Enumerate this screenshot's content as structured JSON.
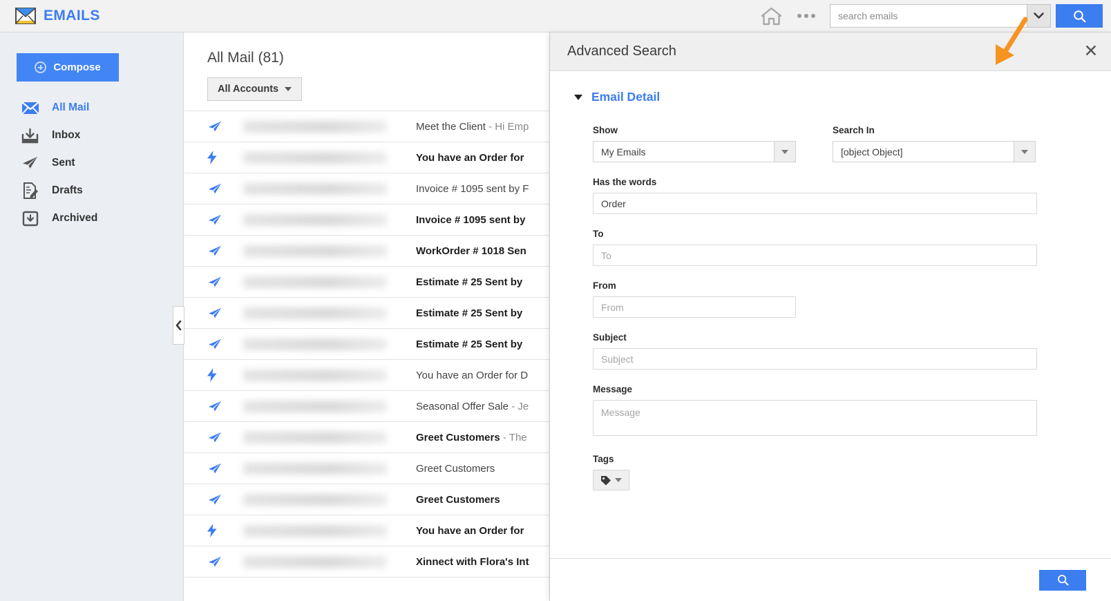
{
  "app": {
    "brand": "EMAILS",
    "brand_icon": "envelope-icon",
    "accent_blue": "#3c7df0",
    "annotation_color": "#f79421"
  },
  "topbar": {
    "home_icon": "home-icon",
    "more_icon": "more-options-icon",
    "search_placeholder": "search emails",
    "search_value": "",
    "dropdown_icon": "chevron-down-icon",
    "search_button_icon": "search-icon"
  },
  "sidebar": {
    "compose_label": "Compose",
    "compose_icon": "plus-circle-icon",
    "items": [
      {
        "label": "All Mail",
        "icon": "envelope-icon",
        "active": true
      },
      {
        "label": "Inbox",
        "icon": "inbox-tray-icon",
        "active": false
      },
      {
        "label": "Sent",
        "icon": "paper-plane-icon",
        "active": false
      },
      {
        "label": "Drafts",
        "icon": "draft-pencil-icon",
        "active": false
      },
      {
        "label": "Archived",
        "icon": "archive-box-icon",
        "active": false
      }
    ],
    "collapse_icon": "chevron-left-icon"
  },
  "list": {
    "title": "All Mail (81)",
    "accounts_filter": "All Accounts",
    "accounts_caret_icon": "caret-down-icon",
    "rows": [
      {
        "icon": "paper-plane-icon",
        "subject": "Meet the Client",
        "preview": " - Hi Emp",
        "unread": false
      },
      {
        "icon": "lightning-bolt-icon",
        "subject": "You have an Order for",
        "preview": "",
        "unread": true
      },
      {
        "icon": "paper-plane-icon",
        "subject": "Invoice # 1095 sent by F",
        "preview": "",
        "unread": false
      },
      {
        "icon": "paper-plane-icon",
        "subject": "Invoice # 1095 sent by",
        "preview": "",
        "unread": true
      },
      {
        "icon": "paper-plane-icon",
        "subject": "WorkOrder # 1018 Sen",
        "preview": "",
        "unread": true
      },
      {
        "icon": "paper-plane-icon",
        "subject": "Estimate # 25 Sent by",
        "preview": "",
        "unread": true
      },
      {
        "icon": "paper-plane-icon",
        "subject": "Estimate # 25 Sent by",
        "preview": "",
        "unread": true
      },
      {
        "icon": "paper-plane-icon",
        "subject": "Estimate # 25 Sent by",
        "preview": "",
        "unread": true
      },
      {
        "icon": "lightning-bolt-icon",
        "subject": "You have an Order for D",
        "preview": "",
        "unread": false
      },
      {
        "icon": "paper-plane-icon",
        "subject": "Seasonal Offer Sale",
        "preview": " - Je",
        "unread": false
      },
      {
        "icon": "paper-plane-icon",
        "subject": "Greet Customers",
        "preview": " - The",
        "unread": true
      },
      {
        "icon": "paper-plane-icon",
        "subject": "Greet Customers",
        "preview": "",
        "unread": false
      },
      {
        "icon": "paper-plane-icon",
        "subject": "Greet Customers",
        "preview": "",
        "unread": true
      },
      {
        "icon": "lightning-bolt-icon",
        "subject": "You have an Order for",
        "preview": "",
        "unread": true
      },
      {
        "icon": "paper-plane-icon",
        "subject": "Xinnect with Flora's Int",
        "preview": "",
        "unread": true
      }
    ]
  },
  "advanced_search": {
    "title": "Advanced Search",
    "close_icon": "close-icon",
    "section": {
      "label": "Email Detail",
      "chevron_icon": "chevron-down-icon",
      "expanded": true
    },
    "show": {
      "label": "Show",
      "value": "My Emails"
    },
    "search_in": {
      "label": "Search In",
      "value": "[object Object]"
    },
    "has_words": {
      "label": "Has the words",
      "value": "Order",
      "placeholder": ""
    },
    "to": {
      "label": "To",
      "value": "",
      "placeholder": "To"
    },
    "from": {
      "label": "From",
      "value": "",
      "placeholder": "From"
    },
    "subject": {
      "label": "Subject",
      "value": "",
      "placeholder": "Subject"
    },
    "message": {
      "label": "Message",
      "value": "",
      "placeholder": "Message"
    },
    "tags": {
      "label": "Tags",
      "icon": "tag-icon",
      "caret_icon": "caret-down-icon"
    },
    "submit_icon": "search-icon"
  }
}
